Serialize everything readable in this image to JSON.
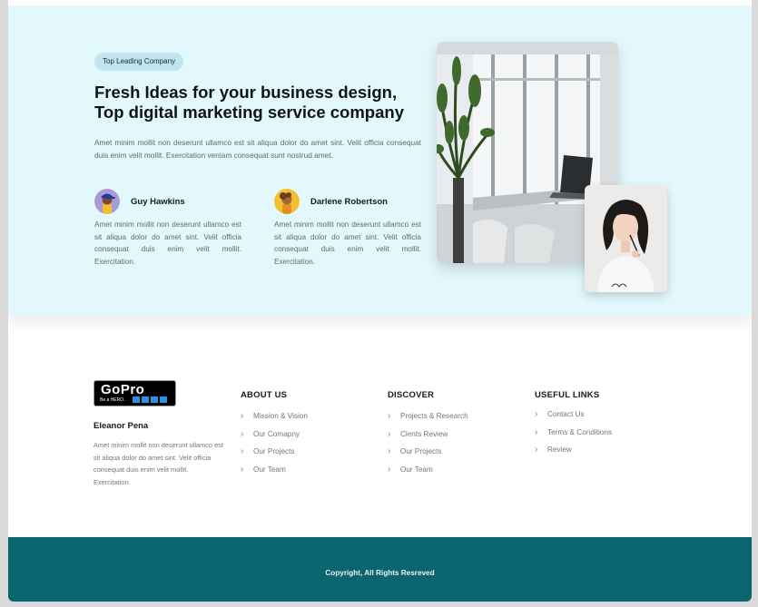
{
  "hero": {
    "badge": "Top Leading Company",
    "headline": "Fresh Ideas for your business design, Top digital marketing service company",
    "lead": "Amet minim mollit non deserunt ullamco est sit aliqua dolor do amet sint. Velit officia consequat duis enim velit mollit. Exercitation veniam consequat sunt nostrud amet.",
    "people": [
      {
        "name": "Guy Hawkins",
        "text": "Amet minim mollit non deserunt ullamco est sit aliqua dolor do amet sint. Velit officia consequat duis enim velit mollit. Exercitation."
      },
      {
        "name": "Darlene Robertson",
        "text": "Amet minim mollit non deserunt ullamco est sit aliqua dolor do amet sint. Velit officia consequat duis enim velit mollit. Exercitation."
      }
    ]
  },
  "footer": {
    "logo_text": "GoPro",
    "logo_tagline": "Be a HERO.",
    "name": "Eleanor Pena",
    "desc": "Amet minim mollit non deserunt ullamco est sit aliqua dolor do amet sint. Velit officia consequat duis enim velit mollit. Exercitation.",
    "columns": [
      {
        "title": "ABOUT US",
        "items": [
          "Mission & Vision",
          "Our Comapny",
          "Our Projects",
          "Our Team"
        ]
      },
      {
        "title": "DISCOVER",
        "items": [
          "Projects & Research",
          "Clents Review",
          "Our Projects",
          "Our Team"
        ]
      },
      {
        "title": "USEFUL LINKS",
        "items": [
          "Contact Us",
          "Terms & Conditions",
          "Review"
        ]
      }
    ],
    "copyright": "Copyright, All Rights Resreved"
  },
  "icons": {
    "link_chevron": "chevron-right-icon"
  },
  "colors": {
    "hero_bg": "#e2f8fd",
    "footer_bar": "#0a6570",
    "badge_bg": "#bfe6ee"
  }
}
